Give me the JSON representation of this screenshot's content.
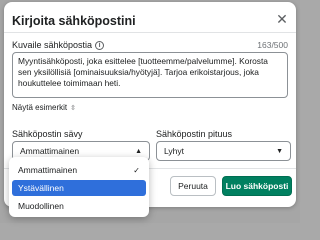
{
  "dialog": {
    "title": "Kirjoita sähköpostini",
    "close_icon": "close-icon",
    "description_label": "Kuvaile sähköpostia",
    "char_count": "163/500",
    "description_text": "Myyntisähköposti, joka esittelee [tuotteemme/palvelumme]. Korosta sen yksilöllisiä [ominaisuuksia/hyötyjä]. Tarjoa erikoistarjous, joka houkuttelee toimimaan heti.",
    "examples_toggle": "Näytä esimerkit",
    "tone_label": "Sähköpostin sävy",
    "tone_selected": "Ammattimainen",
    "length_label": "Sähköpostin pituus",
    "length_selected": "Lyhyt",
    "cancel_label": "Peruuta",
    "create_label": "Luo sähköposti"
  },
  "tone_options": [
    {
      "label": "Ammattimainen",
      "checked": true
    },
    {
      "label": "Ystävällinen",
      "highlighted": true
    },
    {
      "label": "Muodollinen"
    }
  ],
  "colors": {
    "primary_button": "#008060",
    "highlight": "#2f6fdb"
  }
}
